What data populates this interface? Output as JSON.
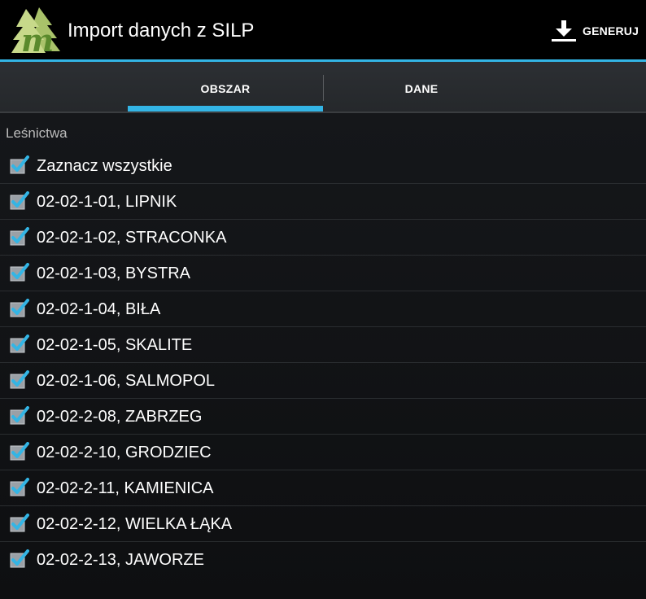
{
  "app": {
    "title": "Import danych z SILP",
    "logo_icon": "forest-m-logo-icon",
    "accent_color": "#33b5e5"
  },
  "actions": {
    "generate_label": "GENERUJ",
    "generate_icon": "download-icon"
  },
  "tabs": [
    {
      "label": "OBSZAR",
      "selected": true
    },
    {
      "label": "DANE",
      "selected": false
    }
  ],
  "section": {
    "header": "Leśnictwa"
  },
  "items": [
    {
      "label": "Zaznacz wszystkie",
      "checked": true
    },
    {
      "label": "02-02-1-01, LIPNIK",
      "checked": true
    },
    {
      "label": "02-02-1-02, STRACONKA",
      "checked": true
    },
    {
      "label": "02-02-1-03, BYSTRA",
      "checked": true
    },
    {
      "label": "02-02-1-04, BIŁA",
      "checked": true
    },
    {
      "label": "02-02-1-05, SKALITE",
      "checked": true
    },
    {
      "label": "02-02-1-06, SALMOPOL",
      "checked": true
    },
    {
      "label": "02-02-2-08, ZABRZEG",
      "checked": true
    },
    {
      "label": "02-02-2-10, GRODZIEC",
      "checked": true
    },
    {
      "label": "02-02-2-11, KAMIENICA",
      "checked": true
    },
    {
      "label": "02-02-2-12, WIELKA ŁĄKA",
      "checked": true
    },
    {
      "label": "02-02-2-13, JAWORZE",
      "checked": true
    }
  ]
}
